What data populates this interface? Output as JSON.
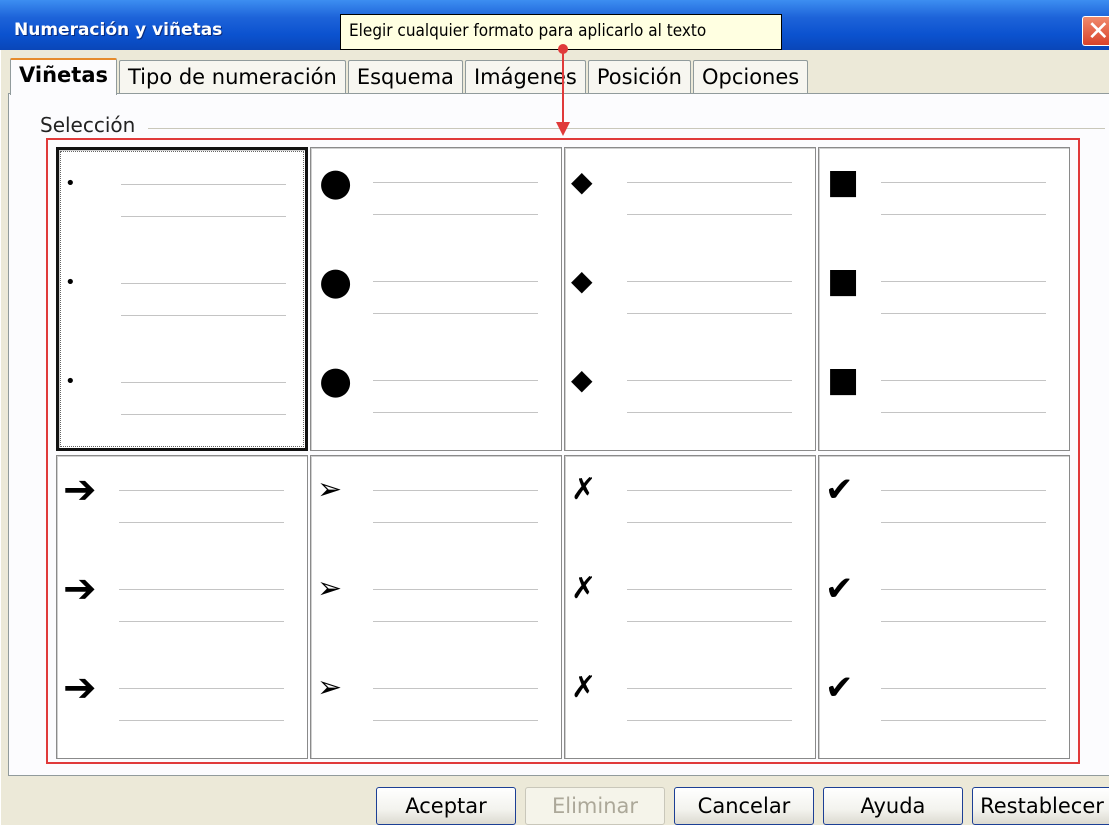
{
  "window": {
    "title": "Numeración y viñetas"
  },
  "tooltip": {
    "text": "Elegir cualquier formato para aplicarlo al texto"
  },
  "tabs": [
    {
      "label": "Viñetas",
      "active": true
    },
    {
      "label": "Tipo de numeración",
      "active": false
    },
    {
      "label": "Esquema",
      "active": false
    },
    {
      "label": "Imágenes",
      "active": false
    },
    {
      "label": "Posición",
      "active": false
    },
    {
      "label": "Opciones",
      "active": false
    }
  ],
  "selection": {
    "label": "Selección",
    "cells": [
      {
        "name": "bullet-small-dot",
        "glyph": "•",
        "selected": true
      },
      {
        "name": "bullet-large-circle",
        "glyph": "●",
        "selected": false
      },
      {
        "name": "bullet-diamond",
        "glyph": "◆",
        "selected": false
      },
      {
        "name": "bullet-square",
        "glyph": "■",
        "selected": false
      },
      {
        "name": "bullet-arrow",
        "glyph": "➔",
        "selected": false
      },
      {
        "name": "bullet-arrowhead",
        "glyph": "➢",
        "selected": false
      },
      {
        "name": "bullet-x-mark",
        "glyph": "✗",
        "selected": false
      },
      {
        "name": "bullet-checkmark",
        "glyph": "✔",
        "selected": false
      }
    ]
  },
  "buttons": {
    "ok": "Aceptar",
    "delete": "Eliminar",
    "cancel": "Cancelar",
    "help": "Ayuda",
    "reset": "Restablecer"
  },
  "colors": {
    "annotation_red": "#e03a3a",
    "title_blue": "#0b52cf",
    "tooltip_bg": "#ffffe1"
  }
}
